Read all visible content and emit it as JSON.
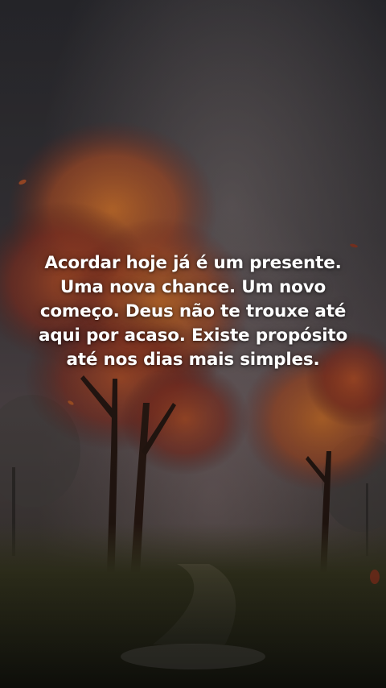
{
  "quote": {
    "lines": [
      "Acordar hoje já é um presente.",
      "Uma nova chance. Um novo",
      "começo. Deus não te trouxe até",
      "aqui por acaso. Existe propósito",
      "até nos dias mais simples."
    ]
  },
  "background": {
    "description_icon": "autumn-trees-painting",
    "colors": {
      "sky_dark": "#2b2b30",
      "sky_mid": "#4a4548",
      "mist": "#7a6e70",
      "foliage_orange": "#c8642a",
      "foliage_red": "#8e2f22",
      "ground": "#3a3a22"
    }
  }
}
